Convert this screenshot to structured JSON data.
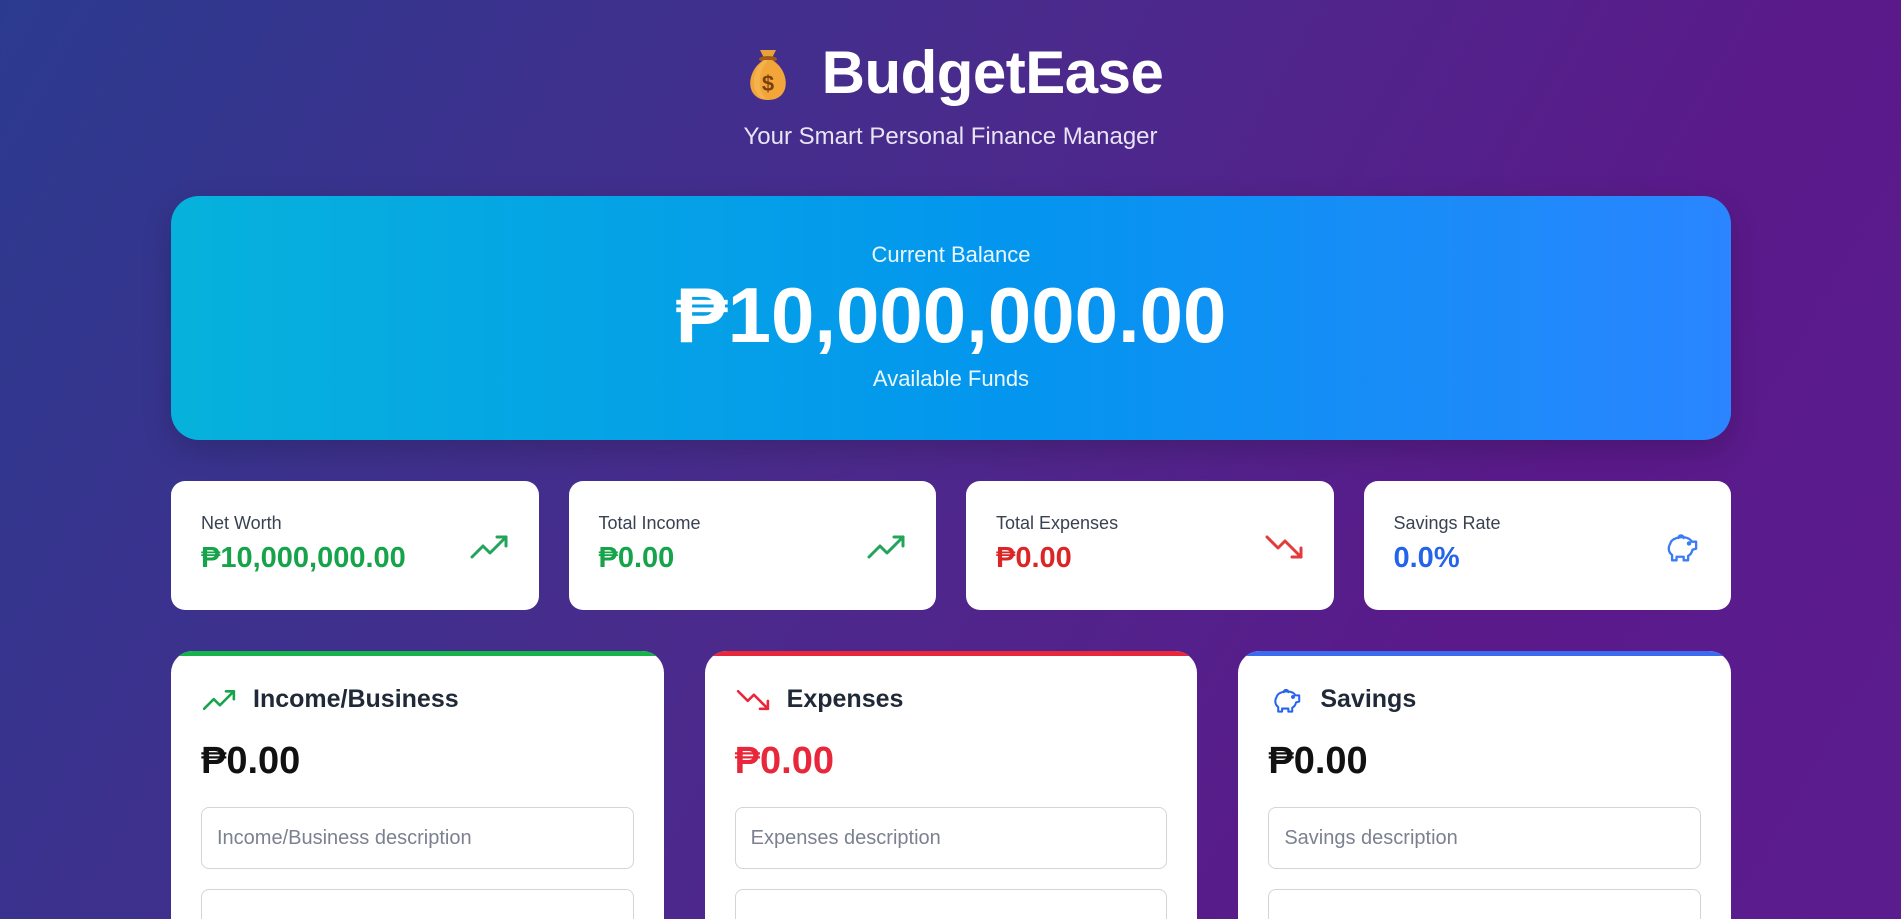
{
  "app": {
    "title": "BudgetEase",
    "subtitle": "Your Smart Personal Finance Manager",
    "logo_icon": "money-bag-icon"
  },
  "balance": {
    "label": "Current Balance",
    "amount": "₱10,000,000.00",
    "caption": "Available Funds"
  },
  "stats": [
    {
      "label": "Net Worth",
      "value": "₱10,000,000.00",
      "icon": "trending-up-icon",
      "color": "#16a34a"
    },
    {
      "label": "Total Income",
      "value": "₱0.00",
      "icon": "trending-up-icon",
      "color": "#16a34a"
    },
    {
      "label": "Total Expenses",
      "value": "₱0.00",
      "icon": "trending-down-icon",
      "color": "#dc2626"
    },
    {
      "label": "Savings Rate",
      "value": "0.0%",
      "icon": "piggy-bank-icon",
      "color": "#2563eb"
    }
  ],
  "panels": [
    {
      "title": "Income/Business",
      "amount": "₱0.00",
      "placeholder": "Income/Business description",
      "icon": "trending-up-icon",
      "accent": "#16b34a"
    },
    {
      "title": "Expenses",
      "amount": "₱0.00",
      "placeholder": "Expenses description",
      "icon": "trending-down-icon",
      "accent": "#e8283a"
    },
    {
      "title": "Savings",
      "amount": "₱0.00",
      "placeholder": "Savings description",
      "icon": "piggy-bank-icon",
      "accent": "#3b6cf0"
    }
  ]
}
